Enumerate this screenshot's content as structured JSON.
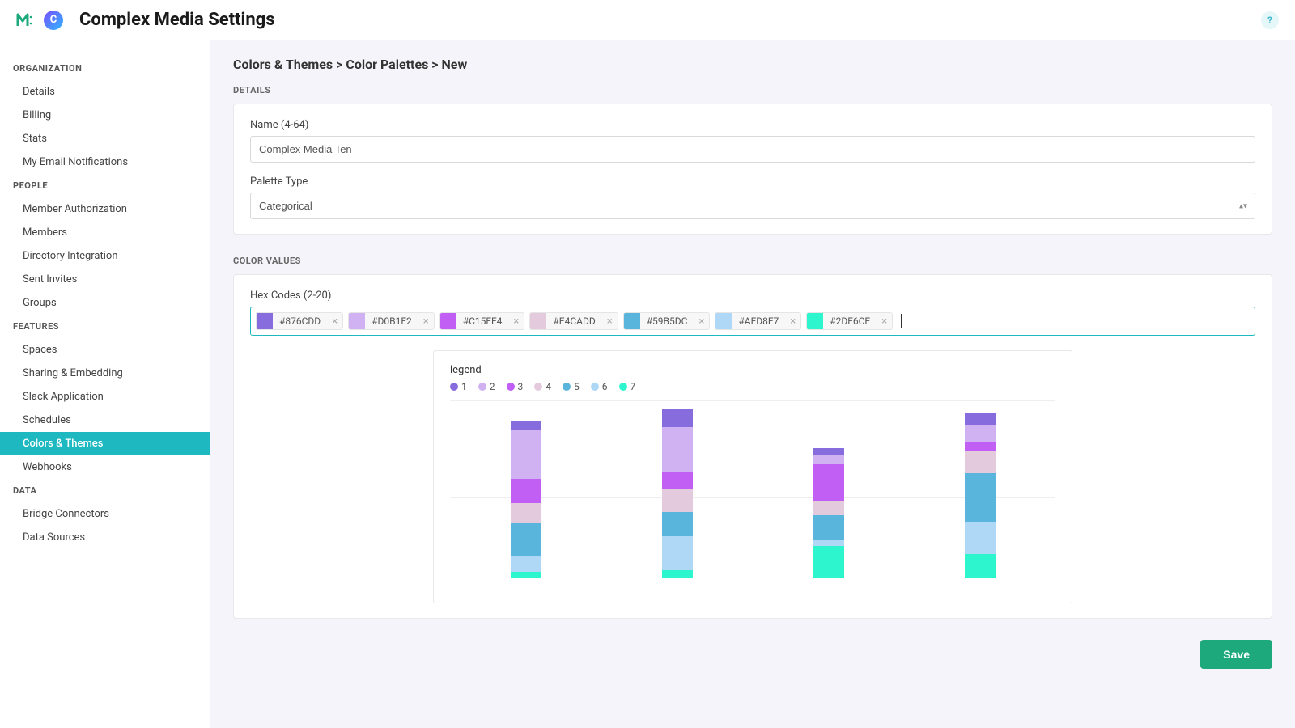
{
  "header": {
    "logo_letter": "C",
    "page_title": "Complex Media Settings",
    "help_label": "?"
  },
  "sidebar": {
    "sections": [
      {
        "heading": "ORGANIZATION",
        "items": [
          "Details",
          "Billing",
          "Stats",
          "My Email Notifications"
        ]
      },
      {
        "heading": "PEOPLE",
        "items": [
          "Member Authorization",
          "Members",
          "Directory Integration",
          "Sent Invites",
          "Groups"
        ]
      },
      {
        "heading": "FEATURES",
        "items": [
          "Spaces",
          "Sharing & Embedding",
          "Slack Application",
          "Schedules",
          "Colors & Themes",
          "Webhooks"
        ]
      },
      {
        "heading": "DATA",
        "items": [
          "Bridge Connectors",
          "Data Sources"
        ]
      }
    ],
    "active": "Colors & Themes"
  },
  "breadcrumb": "Colors & Themes > Color Palettes > New",
  "details_label": "DETAILS",
  "name_label": "Name (4-64)",
  "name_value": "Complex Media Ten",
  "palette_type_label": "Palette Type",
  "palette_type_value": "Categorical",
  "color_values_label": "COLOR VALUES",
  "hex_label": "Hex Codes (2-20)",
  "hex_chips": [
    {
      "hex": "#876CDD"
    },
    {
      "hex": "#D0B1F2"
    },
    {
      "hex": "#C15FF4"
    },
    {
      "hex": "#E4CADD"
    },
    {
      "hex": "#59B5DC"
    },
    {
      "hex": "#AFD8F7"
    },
    {
      "hex": "#2DF6CE"
    }
  ],
  "legend_title": "legend",
  "save_label": "Save",
  "chart_data": {
    "type": "bar",
    "stacked": true,
    "legend": [
      "1",
      "2",
      "3",
      "4",
      "5",
      "6",
      "7"
    ],
    "colors": [
      "#876CDD",
      "#D0B1F2",
      "#C15FF4",
      "#E4CADD",
      "#59B5DC",
      "#AFD8F7",
      "#2DF6CE"
    ],
    "categories": [
      "",
      "",
      "",
      ""
    ],
    "series": [
      {
        "name": "1",
        "values": [
          12,
          22,
          8,
          15
        ]
      },
      {
        "name": "2",
        "values": [
          60,
          55,
          12,
          22
        ]
      },
      {
        "name": "3",
        "values": [
          30,
          22,
          45,
          10
        ]
      },
      {
        "name": "4",
        "values": [
          25,
          28,
          18,
          28
        ]
      },
      {
        "name": "5",
        "values": [
          40,
          30,
          30,
          60
        ]
      },
      {
        "name": "6",
        "values": [
          20,
          42,
          8,
          40
        ]
      },
      {
        "name": "7",
        "values": [
          8,
          10,
          40,
          30
        ]
      }
    ],
    "ylim": [
      0,
      220
    ]
  }
}
